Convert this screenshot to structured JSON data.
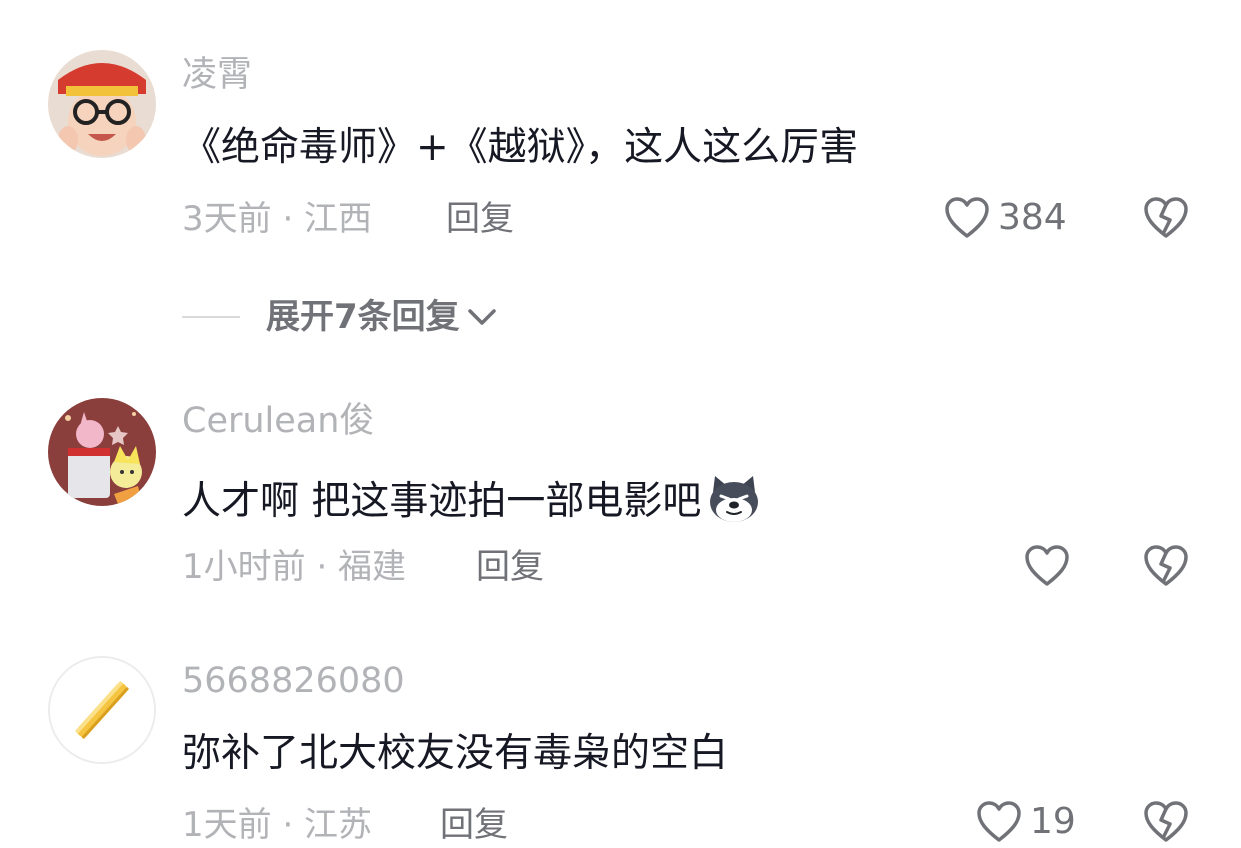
{
  "comments": [
    {
      "username": "凌霄",
      "text": "《绝命毒师》+《越狱》，这人这么厉害",
      "meta": "3天前 · 江西",
      "reply_label": "回复",
      "like_count": "384",
      "expand_label": "展开7条回复"
    },
    {
      "username": "Cerulean俊",
      "text": "人才啊 把这事迹拍一部电影吧",
      "meta": "1小时前 · 福建",
      "reply_label": "回复",
      "like_count": "",
      "emoji": "husky-emoji-icon"
    },
    {
      "username": "5668826080",
      "text": "弥补了北大校友没有毒枭的空白",
      "meta": "1天前 · 江苏",
      "reply_label": "回复",
      "like_count": "19"
    }
  ],
  "colors": {
    "text_primary": "#161823",
    "text_secondary": "#b2b3b7",
    "action_gray": "#707278"
  }
}
